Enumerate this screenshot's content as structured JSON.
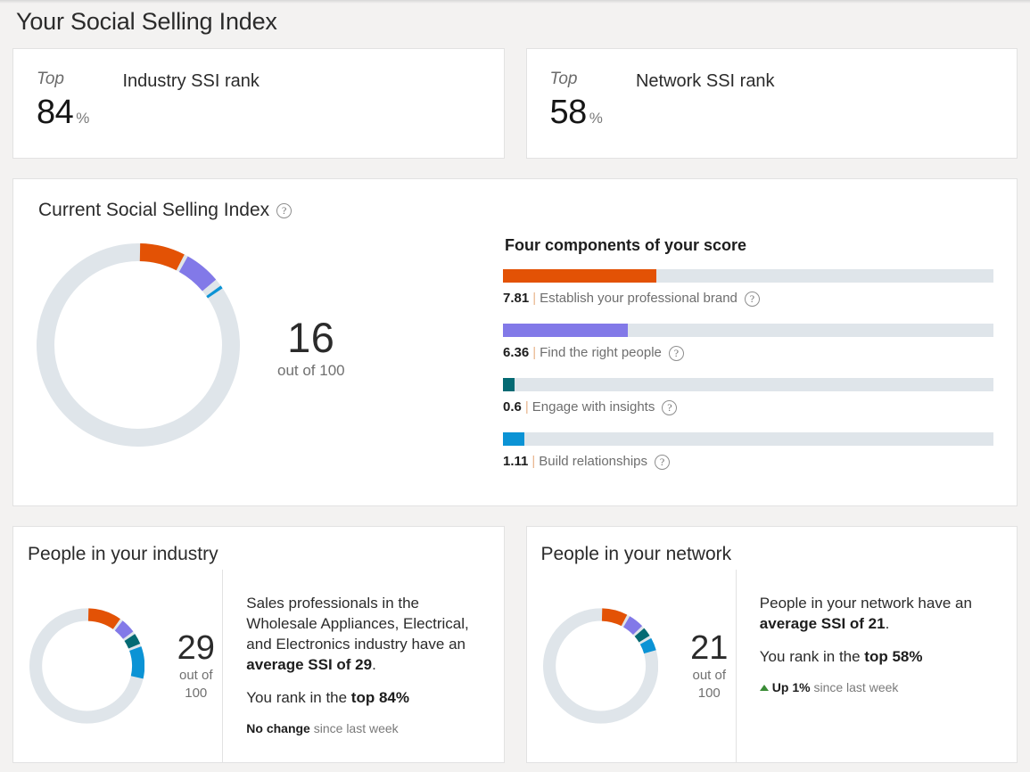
{
  "page": {
    "title": "Your Social Selling Index",
    "background": "#f3f2f1",
    "help_icon_glyph": "?"
  },
  "rank_cards": [
    {
      "top_label": "Top",
      "value": "84",
      "percent_symbol": "%",
      "title": "Industry SSI rank"
    },
    {
      "top_label": "Top",
      "value": "58",
      "percent_symbol": "%",
      "title": "Network SSI rank"
    }
  ],
  "ssi": {
    "card_title": "Current Social Selling Index",
    "score": "16",
    "score_sub": "out of 100",
    "components_title": "Four components of your score",
    "components": [
      {
        "score": "7.81",
        "separator": "|",
        "label": "Establish your professional brand",
        "color": "#e35205",
        "max": 25
      },
      {
        "score": "6.36",
        "separator": "|",
        "label": "Find the right people",
        "color": "#8279e8",
        "max": 25
      },
      {
        "score": "0.6",
        "separator": "|",
        "label": "Engage with insights",
        "color": "#046a73",
        "max": 25
      },
      {
        "score": "1.11",
        "separator": "|",
        "label": "Build relationships",
        "color": "#0b93d5",
        "max": 25
      }
    ]
  },
  "industry_card": {
    "title": "People in your industry",
    "score": "29",
    "score_sub": "out of 100",
    "description_prefix": "Sales professionals in the Wholesale Appliances, Electrical, and Electronics industry have an ",
    "description_bold": "average SSI of 29",
    "description_suffix": ".",
    "rank_prefix": "You rank in the ",
    "rank_bold": "top 84%",
    "change_bold": "No change",
    "change_suffix": " since last week",
    "segments": [
      {
        "value": 10.2,
        "color": "#e35205"
      },
      {
        "value": 5.0,
        "color": "#8279e8"
      },
      {
        "value": 3.9,
        "color": "#046a73"
      },
      {
        "value": 9.9,
        "color": "#0b93d5"
      }
    ]
  },
  "network_card": {
    "title": "People in your network",
    "score": "21",
    "score_sub": "out of 100",
    "description_prefix": "People in your network have an ",
    "description_bold": "average SSI of 21",
    "description_suffix": ".",
    "rank_prefix": "You rank in the ",
    "rank_bold": "top 58%",
    "change_arrow": "up-triangle",
    "change_bold": "Up 1%",
    "change_suffix": " since last week",
    "change_color": "#3a8c36",
    "segments": [
      {
        "value": 8.0,
        "color": "#e35205"
      },
      {
        "value": 5.2,
        "color": "#8279e8"
      },
      {
        "value": 3.4,
        "color": "#046a73"
      },
      {
        "value": 4.4,
        "color": "#0b93d5"
      }
    ]
  },
  "chart_data": {
    "type": "pie",
    "title": "Current Social Selling Index",
    "total_max": 100,
    "charts": [
      {
        "name": "current-ssi-donut",
        "total": 16,
        "out_of": 100,
        "slices": [
          {
            "label": "Establish your professional brand",
            "value": 7.81,
            "color": "#e35205"
          },
          {
            "label": "Find the right people",
            "value": 6.36,
            "color": "#8279e8"
          },
          {
            "label": "Engage with insights",
            "value": 0.6,
            "color": "#046a73"
          },
          {
            "label": "Build relationships",
            "value": 1.11,
            "color": "#0b93d5"
          },
          {
            "label": "Remaining",
            "value": 84.12,
            "color": "#dfe5ea"
          }
        ]
      },
      {
        "name": "industry-donut",
        "total": 29,
        "out_of": 100,
        "slices": [
          {
            "label": "Establish your professional brand",
            "value": 10.2,
            "color": "#e35205"
          },
          {
            "label": "Find the right people",
            "value": 5.0,
            "color": "#8279e8"
          },
          {
            "label": "Engage with insights",
            "value": 3.9,
            "color": "#046a73"
          },
          {
            "label": "Build relationships",
            "value": 9.9,
            "color": "#0b93d5"
          },
          {
            "label": "Remaining",
            "value": 71.0,
            "color": "#dfe5ea"
          }
        ]
      },
      {
        "name": "network-donut",
        "total": 21,
        "out_of": 100,
        "slices": [
          {
            "label": "Establish your professional brand",
            "value": 8.0,
            "color": "#e35205"
          },
          {
            "label": "Find the right people",
            "value": 5.2,
            "color": "#8279e8"
          },
          {
            "label": "Engage with insights",
            "value": 3.4,
            "color": "#046a73"
          },
          {
            "label": "Build relationships",
            "value": 4.4,
            "color": "#0b93d5"
          },
          {
            "label": "Remaining",
            "value": 79.0,
            "color": "#dfe5ea"
          }
        ]
      }
    ],
    "bar_chart": {
      "type": "bar",
      "title": "Four components of your score",
      "orientation": "horizontal",
      "categories": [
        "Establish your professional brand",
        "Find the right people",
        "Engage with insights",
        "Build relationships"
      ],
      "values": [
        7.81,
        6.36,
        0.6,
        1.11
      ],
      "xlim": [
        0,
        25
      ],
      "colors": [
        "#e35205",
        "#8279e8",
        "#046a73",
        "#0b93d5"
      ],
      "track_color": "#dfe5ea"
    }
  }
}
